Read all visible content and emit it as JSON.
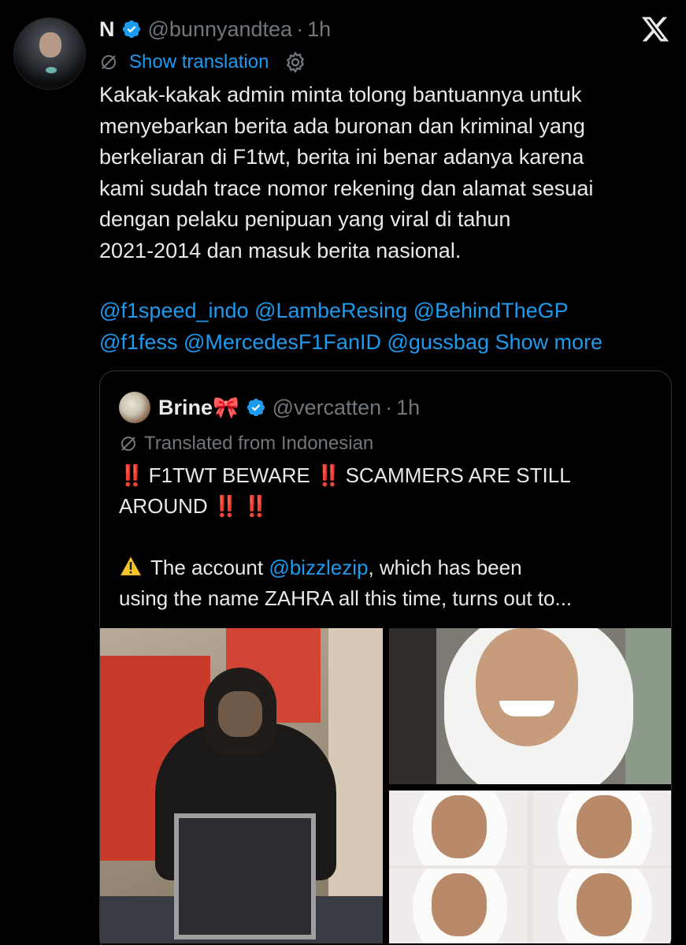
{
  "post": {
    "author_name": "N",
    "author_handle": "@bunnyandtea",
    "separator": "·",
    "time": "1h",
    "show_translation": "Show translation",
    "text_lines": [
      "Kakak-kakak admin minta tolong bantuannya untuk",
      "menyebarkan berita ada buronan dan kriminal yang",
      "berkeliaran di F1twt, berita ini benar adanya karena",
      "kami sudah trace nomor rekening dan alamat sesuai",
      "dengan pelaku penipuan yang viral di tahun",
      "2021-2014 dan masuk berita nasional."
    ],
    "mentions": [
      "@f1speed_indo",
      "@LambeResing",
      "@BehindTheGP",
      "@f1fess",
      "@MercedesF1FanID",
      "@gussbag"
    ],
    "show_more": "Show more"
  },
  "quote": {
    "author_name": "Brine🎀",
    "author_handle": "@vercatten",
    "separator": "·",
    "time": "1h",
    "translated_label": "Translated from Indonesian",
    "headline_part1": "F1TWT BEWARE",
    "headline_part2": "SCAMMERS ARE STILL",
    "headline_part3": "AROUND",
    "bang": "‼️",
    "body_prefix": "The account",
    "body_mention": "@bizzlezip",
    "body_suffix": ", which has been",
    "body_line2": "using the name ZAHRA all this time, turns out to..."
  },
  "icons": {
    "verified": "verified-badge-icon",
    "x_logo": "x-logo-icon",
    "translate": "translate-slash-icon",
    "settings": "gear-icon",
    "warning": "warning-icon"
  },
  "colors": {
    "background": "#000000",
    "text": "#e7e9ea",
    "secondary": "#71767b",
    "link": "#1d9bf0",
    "border": "#2f3336",
    "alert": "#e0242c"
  }
}
